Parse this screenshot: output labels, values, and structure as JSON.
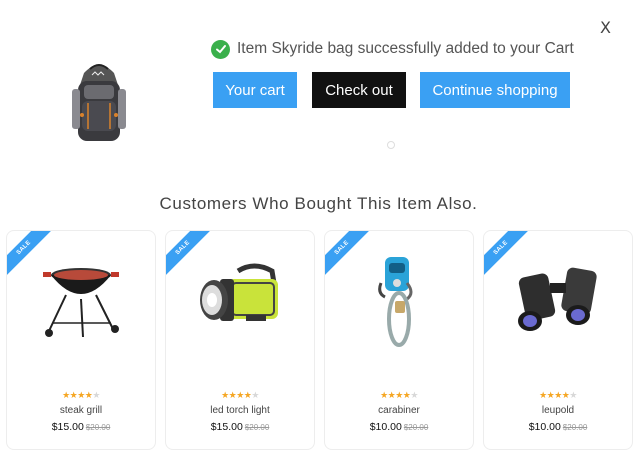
{
  "modal": {
    "close_label": "X",
    "success_message": "Item Skyride bag successfully added to your Cart",
    "buttons": {
      "your_cart": "Your cart",
      "check_out": "Check out",
      "continue_shopping": "Continue shopping"
    },
    "colors": {
      "accent": "#3aa0f3",
      "success": "#3ab04b",
      "dark_button": "#111111",
      "star": "#f5a623"
    }
  },
  "related": {
    "title": "Customers Who Bought This Item Also.",
    "sale_label": "SALE",
    "products": [
      {
        "name": "steak grill",
        "price": "$15.00",
        "old_price": "$20.00",
        "rating": 4,
        "icon": "grill-icon"
      },
      {
        "name": "led torch light",
        "price": "$15.00",
        "old_price": "$20.00",
        "rating": 4,
        "icon": "torch-icon"
      },
      {
        "name": "carabiner",
        "price": "$10.00",
        "old_price": "$20.00",
        "rating": 4,
        "icon": "carabiner-icon"
      },
      {
        "name": "leupold",
        "price": "$10.00",
        "old_price": "$20.00",
        "rating": 4,
        "icon": "binoculars-icon"
      }
    ]
  }
}
